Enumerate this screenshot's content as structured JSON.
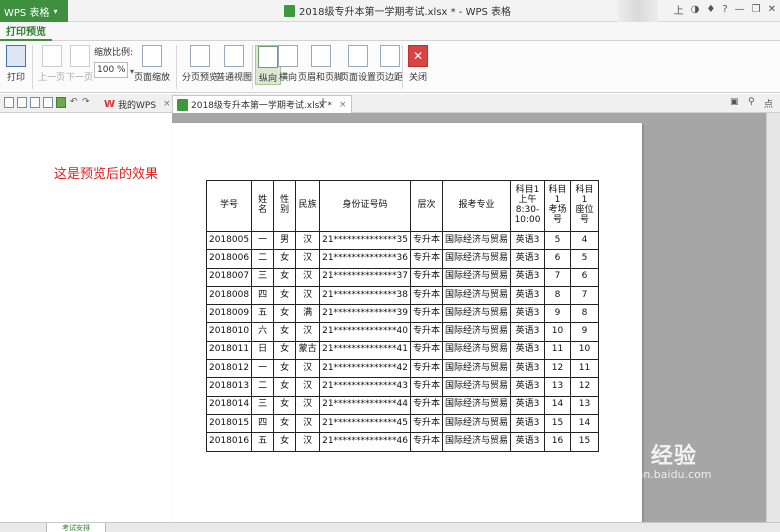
{
  "titlebar": {
    "app_button": "WPS 表格",
    "window_title": "2018级专升本第一学期考试.xlsx * - WPS 表格",
    "user_label": "上"
  },
  "ribbon_tab": {
    "active": "打印预览"
  },
  "ribbon": {
    "print": "打印",
    "prev_page": "上一页",
    "next_page": "下一页",
    "zoom_label": "缩放比例:",
    "zoom_value": "100 %",
    "page_zoom": "页面缩放",
    "page_break_preview": "分页预览",
    "normal_view": "普通视图",
    "portrait": "纵向",
    "landscape": "横向",
    "header_footer": "页眉和页脚",
    "page_setup": "页面设置",
    "margins": "页边距",
    "close": "关闭"
  },
  "doc_tabs": {
    "home_tab": "我的WPS",
    "file_tab": "2018级专升本第一学期考试.xlsx *",
    "right_label": "点"
  },
  "annotation": "这是预览后的效果",
  "table": {
    "headers": [
      "学号",
      "姓名",
      "性别",
      "民族",
      "身份证号码",
      "层次",
      "报考专业",
      "科目1\n上午\n8:30-\n10:00",
      "科目1\n考场号",
      "科目1\n座位号"
    ],
    "rows": [
      [
        "2018005",
        "一",
        "男",
        "汉",
        "21**************35",
        "专升本",
        "国际经济与贸易",
        "英语3",
        "5",
        "4"
      ],
      [
        "2018006",
        "二",
        "女",
        "汉",
        "21**************36",
        "专升本",
        "国际经济与贸易",
        "英语3",
        "6",
        "5"
      ],
      [
        "2018007",
        "三",
        "女",
        "汉",
        "21**************37",
        "专升本",
        "国际经济与贸易",
        "英语3",
        "7",
        "6"
      ],
      [
        "2018008",
        "四",
        "女",
        "汉",
        "21**************38",
        "专升本",
        "国际经济与贸易",
        "英语3",
        "8",
        "7"
      ],
      [
        "2018009",
        "五",
        "女",
        "满",
        "21**************39",
        "专升本",
        "国际经济与贸易",
        "英语3",
        "9",
        "8"
      ],
      [
        "2018010",
        "六",
        "女",
        "汉",
        "21**************40",
        "专升本",
        "国际经济与贸易",
        "英语3",
        "10",
        "9"
      ],
      [
        "2018011",
        "日",
        "女",
        "蒙古",
        "21**************41",
        "专升本",
        "国际经济与贸易",
        "英语3",
        "11",
        "10"
      ],
      [
        "2018012",
        "一",
        "女",
        "汉",
        "21**************42",
        "专升本",
        "国际经济与贸易",
        "英语3",
        "12",
        "11"
      ],
      [
        "2018013",
        "二",
        "女",
        "汉",
        "21**************43",
        "专升本",
        "国际经济与贸易",
        "英语3",
        "13",
        "12"
      ],
      [
        "2018014",
        "三",
        "女",
        "汉",
        "21**************44",
        "专升本",
        "国际经济与贸易",
        "英语3",
        "14",
        "13"
      ],
      [
        "2018015",
        "四",
        "女",
        "汉",
        "21**************45",
        "专升本",
        "国际经济与贸易",
        "英语3",
        "15",
        "14"
      ],
      [
        "2018016",
        "五",
        "女",
        "汉",
        "21**************46",
        "专升本",
        "国际经济与贸易",
        "英语3",
        "16",
        "15"
      ]
    ]
  },
  "watermark": {
    "logo": "Bai 经验",
    "url": "jingyan.baidu.com"
  },
  "status": {
    "sheet_tab": "考试安排"
  },
  "icons": {
    "print": "printer-icon",
    "close": "close-icon",
    "portrait": "portrait-icon",
    "landscape": "landscape-icon"
  },
  "colors": {
    "accent": "#3e8f3e",
    "annotation": "#e02020",
    "workspace": "#a6a6a6"
  }
}
